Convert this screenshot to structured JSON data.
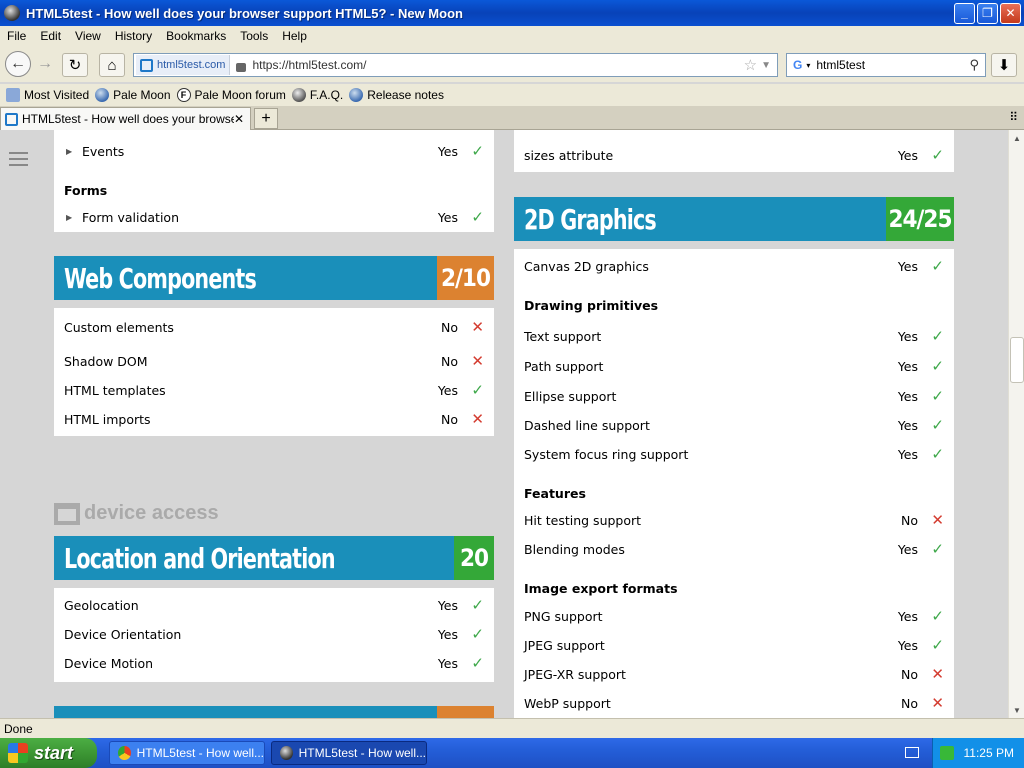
{
  "window": {
    "title": "HTML5test - How well does your browser support HTML5? - New Moon"
  },
  "menu": [
    "File",
    "Edit",
    "View",
    "History",
    "Bookmarks",
    "Tools",
    "Help"
  ],
  "nav": {
    "site_identity": "html5test.com",
    "url": "https://html5test.com/",
    "search_value": "html5test"
  },
  "bookmarks": [
    "Most Visited",
    "Pale Moon",
    "Pale Moon forum",
    "F.A.Q.",
    "Release notes"
  ],
  "tab": {
    "label": "HTML5test - How well does your browser...",
    "new_tab": "+"
  },
  "left": {
    "events": {
      "label": "Events",
      "value": "Yes"
    },
    "forms": {
      "title": "Forms",
      "label": "Form validation",
      "value": "Yes"
    },
    "webcomponents": {
      "title": "Web Components",
      "score": "2/10",
      "rows": [
        {
          "label": "Custom elements",
          "value": "No",
          "ok": false
        },
        {
          "label": "Shadow DOM",
          "value": "No",
          "ok": false
        },
        {
          "label": "HTML templates",
          "value": "Yes",
          "ok": true
        },
        {
          "label": "HTML imports",
          "value": "No",
          "ok": false
        }
      ]
    },
    "device_access": "device access",
    "location": {
      "title": "Location and Orientation",
      "score": "20",
      "rows": [
        {
          "label": "Geolocation",
          "value": "Yes",
          "ok": true
        },
        {
          "label": "Device Orientation",
          "value": "Yes",
          "ok": true
        },
        {
          "label": "Device Motion",
          "value": "Yes",
          "ok": true
        }
      ]
    }
  },
  "right": {
    "sizes": {
      "label": "sizes attribute",
      "value": "Yes"
    },
    "graphics": {
      "title": "2D Graphics",
      "score": "24/25",
      "canvas": {
        "label": "Canvas 2D graphics",
        "value": "Yes"
      },
      "drawing_title": "Drawing primitives",
      "drawing": [
        {
          "label": "Text support",
          "value": "Yes",
          "ok": true
        },
        {
          "label": "Path support",
          "value": "Yes",
          "ok": true
        },
        {
          "label": "Ellipse support",
          "value": "Yes",
          "ok": true
        },
        {
          "label": "Dashed line support",
          "value": "Yes",
          "ok": true
        },
        {
          "label": "System focus ring support",
          "value": "Yes",
          "ok": true
        }
      ],
      "features_title": "Features",
      "features": [
        {
          "label": "Hit testing support",
          "value": "No",
          "ok": false
        },
        {
          "label": "Blending modes",
          "value": "Yes",
          "ok": true
        }
      ],
      "export_title": "Image export formats",
      "export": [
        {
          "label": "PNG support",
          "value": "Yes",
          "ok": true
        },
        {
          "label": "JPEG support",
          "value": "Yes",
          "ok": true
        },
        {
          "label": "JPEG-XR support",
          "value": "No",
          "ok": false
        },
        {
          "label": "WebP support",
          "value": "No",
          "ok": false
        }
      ]
    }
  },
  "status": "Done",
  "taskbar": {
    "start": "start",
    "item1": "HTML5test - How well...",
    "item2": "HTML5test - How well...",
    "clock": "11:25 PM"
  },
  "colors": {
    "header_blue": "#1a8fba",
    "score_orange": "#dc8230",
    "score_green": "#34a838",
    "yes_green": "#3ea84a",
    "no_red": "#d43c30"
  }
}
